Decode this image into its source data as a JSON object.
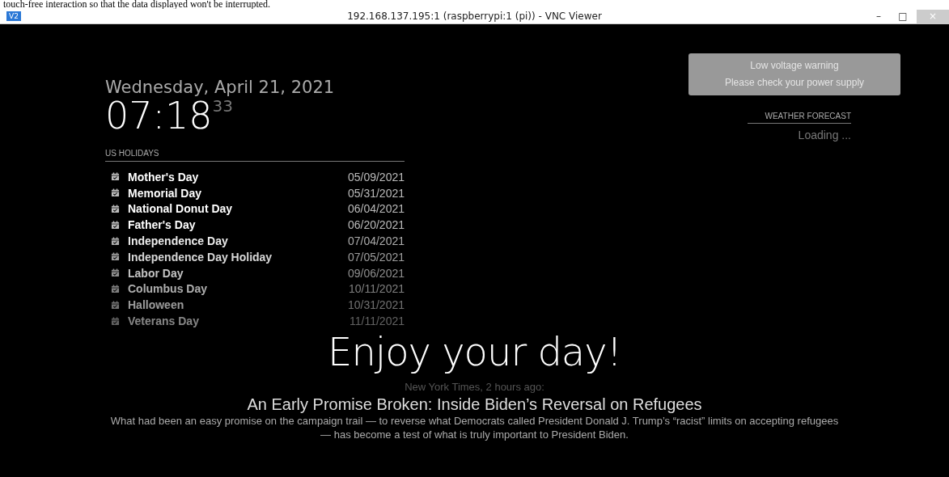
{
  "document_caption": "touch-free interaction so that the data displayed won't be interrupted.",
  "window": {
    "app_badge": "V2",
    "title": "192.168.137.195:1 (raspberrypi:1 (pi)) - VNC Viewer",
    "controls": [
      "–",
      "□",
      "×"
    ]
  },
  "clock": {
    "date": "Wednesday, April 21, 2021",
    "time": "07:18",
    "seconds": "33"
  },
  "holidays": {
    "header": "US HOLIDAYS",
    "rows": [
      {
        "name": "Mother's Day",
        "date": "05/09/2021"
      },
      {
        "name": "Memorial Day",
        "date": "05/31/2021"
      },
      {
        "name": "National Donut Day",
        "date": "06/04/2021"
      },
      {
        "name": "Father's Day",
        "date": "06/20/2021"
      },
      {
        "name": "Independence Day",
        "date": "07/04/2021"
      },
      {
        "name": "Independence Day Holiday",
        "date": "07/05/2021"
      },
      {
        "name": "Labor Day",
        "date": "09/06/2021"
      },
      {
        "name": "Columbus Day",
        "date": "10/11/2021"
      },
      {
        "name": "Halloween",
        "date": "10/31/2021"
      },
      {
        "name": "Veterans Day",
        "date": "11/11/2021"
      }
    ]
  },
  "notification": {
    "title": "Low voltage warning",
    "message": "Please check your power supply"
  },
  "weather": {
    "header": "WEATHER FORECAST",
    "status": "Loading ..."
  },
  "compliment": "Enjoy your day!",
  "news": {
    "source": "New York Times, 2 hours ago:",
    "headline": "An Early Promise Broken: Inside Biden’s Reversal on Refugees",
    "description": "What had been an easy promise on the campaign trail — to reverse what Democrats called President Donald J. Trump’s “racist” limits on accepting refugees — has become a test of what is truly important to President Biden."
  }
}
